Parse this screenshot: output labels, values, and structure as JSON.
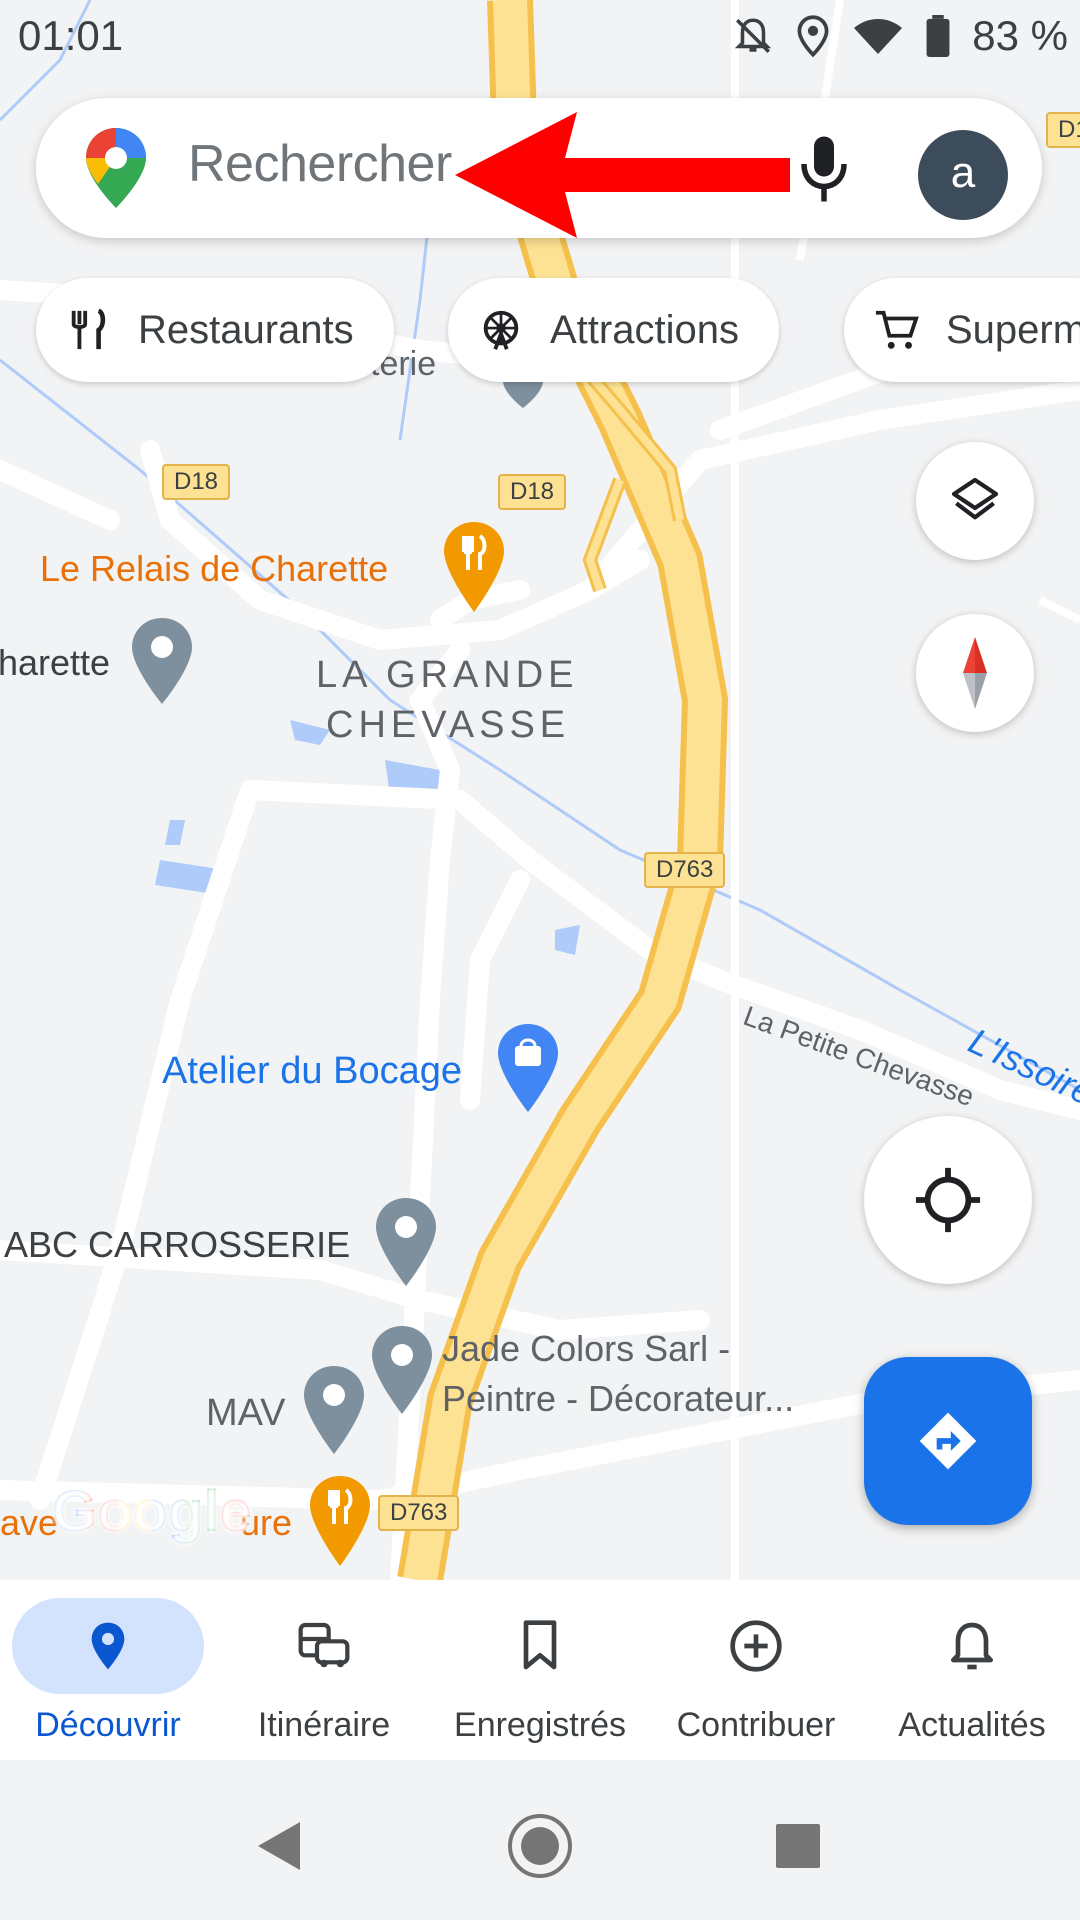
{
  "status_bar": {
    "time": "01:01",
    "battery": "83 %"
  },
  "search": {
    "placeholder": "Rechercher",
    "avatar_letter": "a"
  },
  "chips": [
    {
      "label": "Restaurants",
      "icon": "fork-knife-icon"
    },
    {
      "label": "Attractions",
      "icon": "ferris-wheel-icon"
    },
    {
      "label": "Superm",
      "icon": "shopping-cart-icon"
    }
  ],
  "map": {
    "place_labels": {
      "relais": "Le Relais de Charette",
      "charette": "harette",
      "grande_chevasse_1": "LA GRANDE",
      "grande_chevasse_2": "CHEVASSE",
      "atelier": "Atelier du Bocage",
      "abc": "ABC CARROSSERIE",
      "jade_1": "Jade Colors Sarl -",
      "jade_2": "Peintre - Décorateur...",
      "mav": "MAV",
      "petite_chevasse": "La Petite Chevasse",
      "issoire": "L'Issoire",
      "partial_top": "terie",
      "bottom_left_1": "ave",
      "bottom_left_2": "ure"
    },
    "road_shields": [
      "D18",
      "D18",
      "D763",
      "D763",
      "D1"
    ],
    "attribution": "Google"
  },
  "bottom_nav": [
    {
      "label": "Découvrir",
      "icon": "location-pin-icon",
      "active": true
    },
    {
      "label": "Itinéraire",
      "icon": "commute-icon",
      "active": false
    },
    {
      "label": "Enregistrés",
      "icon": "bookmark-icon",
      "active": false
    },
    {
      "label": "Contribuer",
      "icon": "add-circle-icon",
      "active": false
    },
    {
      "label": "Actualités",
      "icon": "bell-icon",
      "active": false
    }
  ],
  "colors": {
    "accent": "#1a73e8",
    "active_text": "#0b57d0",
    "active_pill": "#d3e3fd",
    "restaurant_orange": "#e8710a",
    "shop_blue": "#1a73e8",
    "highway_yellow": "#fbc957",
    "annotation_arrow": "#ff0000"
  }
}
